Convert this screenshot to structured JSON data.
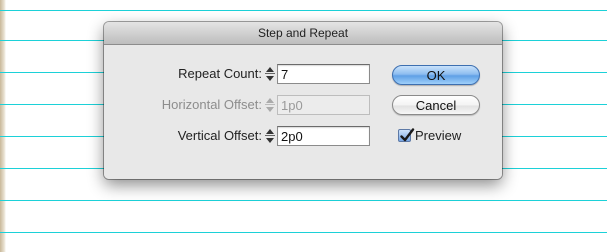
{
  "dialog": {
    "title": "Step and Repeat"
  },
  "fields": [
    {
      "label": "Repeat Count:",
      "value": "7",
      "enabled": true
    },
    {
      "label": "Horizontal Offset:",
      "value": "1p0",
      "enabled": false
    },
    {
      "label": "Vertical Offset:",
      "value": "2p0",
      "enabled": true
    }
  ],
  "buttons": {
    "ok_label": "OK",
    "cancel_label": "Cancel"
  },
  "preview": {
    "label": "Preview",
    "checked": true
  },
  "colors": {
    "guide_line": "#1cd1d8",
    "ok_button_accent": "#5fa0e6"
  },
  "icons": {
    "stepper": "up-down-arrows-icon",
    "checkmark": "checkmark-icon"
  }
}
